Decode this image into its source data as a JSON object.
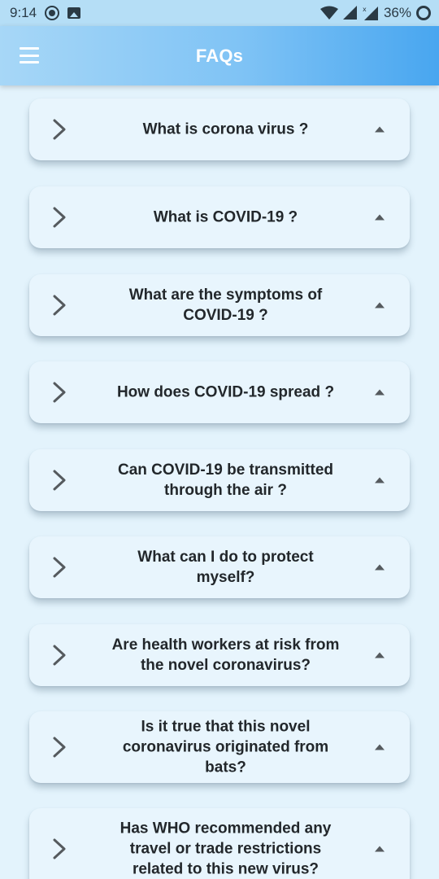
{
  "status_bar": {
    "time": "9:14",
    "battery": "36%",
    "icons": [
      "record-icon",
      "image-icon",
      "wifi-icon",
      "signal-icon",
      "signal-x-icon",
      "battery-ring-icon"
    ]
  },
  "app_bar": {
    "title": "FAQs",
    "menu_icon": "hamburger-menu-icon"
  },
  "faqs": [
    {
      "question": "What is corona virus ?"
    },
    {
      "question": "What is COVID-19 ?"
    },
    {
      "question": "What are the symptoms of COVID-19 ?"
    },
    {
      "question": "How does COVID-19 spread ?"
    },
    {
      "question": "Can COVID-19 be transmitted through the air ?"
    },
    {
      "question": "What can I do to protect myself?"
    },
    {
      "question": "Are health workers at risk from the novel coronavirus?"
    },
    {
      "question": "Is it true that this novel coronavirus originated from bats?"
    },
    {
      "question": "Has WHO recommended any travel or trade restrictions related to this new virus?"
    }
  ],
  "colors": {
    "background": "#e3f3fc",
    "card": "#e8f5fd",
    "app_bar_start": "#a7d7f7",
    "app_bar_end": "#48a6f0",
    "text": "#22272b",
    "icon": "#555a5e"
  }
}
